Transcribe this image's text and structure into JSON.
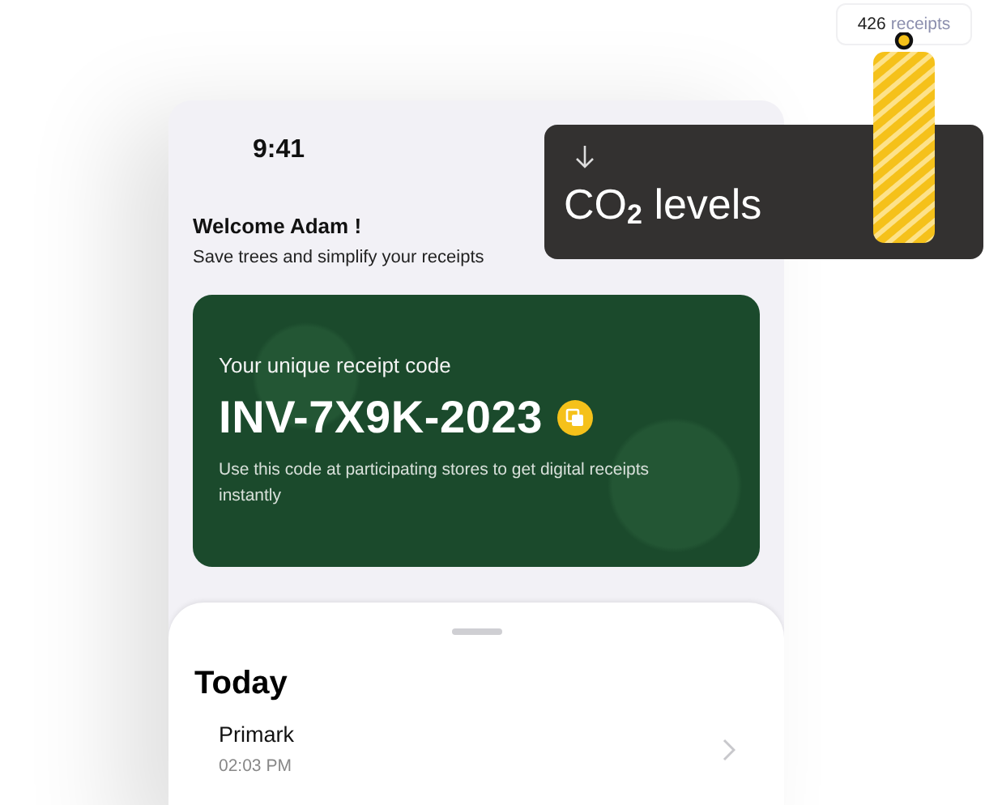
{
  "status_bar": {
    "time": "9:41"
  },
  "welcome": {
    "title": "Welcome Adam !",
    "subtitle": "Save trees and simplify your receipts"
  },
  "code_card": {
    "label": "Your unique receipt code",
    "code": "INV-7X9K-2023",
    "note": "Use this code at participating stores to get digital receipts instantly"
  },
  "sheet": {
    "title": "Today",
    "receipts": [
      {
        "store": "Primark",
        "time": "02:03 PM"
      }
    ]
  },
  "co2_card": {
    "title": "CO$_{2}$ levels"
  },
  "receipt_tag": {
    "count": "426",
    "label": "receipts"
  }
}
